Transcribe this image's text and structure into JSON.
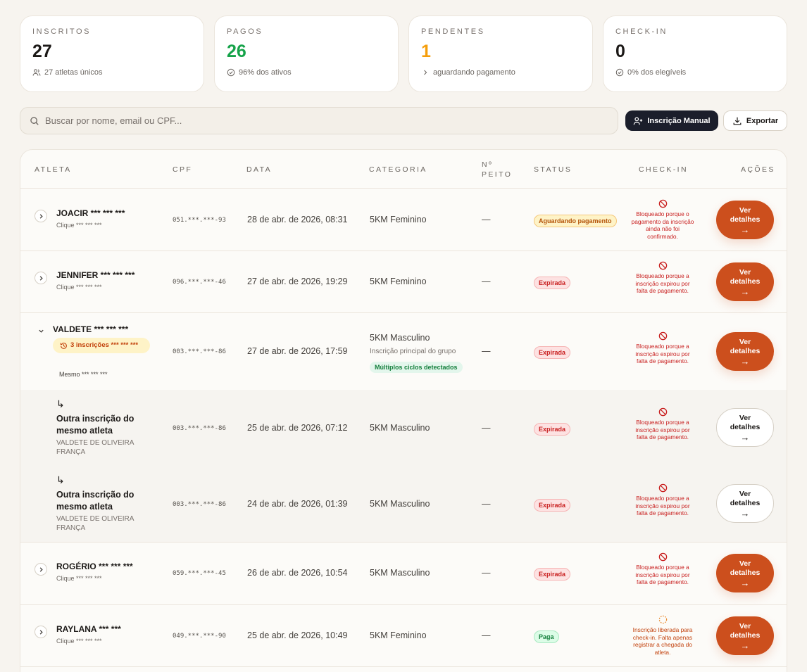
{
  "stats": [
    {
      "label": "INSCRITOS",
      "value": "27",
      "sub": "27 atletas únicos",
      "color": "#1c1917",
      "icon": "users-icon"
    },
    {
      "label": "PAGOS",
      "value": "26",
      "sub": "96% dos ativos",
      "color": "#16a34a",
      "icon": "check-circle-icon"
    },
    {
      "label": "PENDENTES",
      "value": "1",
      "sub": "aguardando pagamento",
      "color": "#f59e0b",
      "icon": "chevron-right-icon"
    },
    {
      "label": "CHECK-IN",
      "value": "0",
      "sub": "0% dos elegíveis",
      "color": "#1c1917",
      "icon": "check-circle-icon"
    }
  ],
  "search": {
    "placeholder": "Buscar por nome, email ou CPF..."
  },
  "buttons": {
    "manual": "Inscrição Manual",
    "export": "Exportar"
  },
  "table": {
    "headers": {
      "athlete": "ATLETA",
      "cpf": "CPF",
      "date": "DATA",
      "category": "CATEGORIA",
      "bib_line1": "Nº",
      "bib_line2": "PEITO",
      "status": "STATUS",
      "checkin": "CHECK-IN",
      "actions": "AÇÕES"
    },
    "rows": [
      {
        "name": "JOACIR *** *** ***",
        "sub": "Clique *** *** ***",
        "cpf": "051.***.***-93",
        "date": "28 de abr. de 2026, 08:31",
        "category": "5KM Feminino",
        "bib": "—",
        "status": "Aguardando pagamento",
        "checkin": "Bloqueado porque o pagamento da inscrição ainda não foi confirmado.",
        "action": "Ver detalhes"
      },
      {
        "name": "JENNIFER *** *** ***",
        "sub": "Clique *** *** ***",
        "cpf": "096.***.***-46",
        "date": "27 de abr. de 2026, 19:29",
        "category": "5KM Feminino",
        "bib": "—",
        "status": "Expirada",
        "checkin": "Bloqueado porque a inscrição expirou por falta de pagamento.",
        "action": "Ver detalhes"
      },
      {
        "name": "VALDETE *** *** ***",
        "multi": "3 inscrições *** *** ***",
        "sub": "Mesmo *** *** ***",
        "cpf": "003.***.***-86",
        "date": "27 de abr. de 2026, 17:59",
        "category": "5KM Masculino",
        "category_sub": "Inscrição principal do grupo",
        "cycles": "Múltiplos ciclos detectados",
        "bib": "—",
        "status": "Expirada",
        "checkin": "Bloqueado porque a inscrição expirou por falta de pagamento.",
        "action": "Ver detalhes"
      },
      {
        "arrow": "↳",
        "title": "Outra inscrição do mesmo atleta",
        "sub": "VALDETE DE OLIVEIRA FRANÇA",
        "cpf": "003.***.***-86",
        "date": "25 de abr. de 2026, 07:12",
        "category": "5KM Masculino",
        "bib": "—",
        "status": "Expirada",
        "checkin": "Bloqueado porque a inscrição expirou por falta de pagamento.",
        "action": "Ver detalhes"
      },
      {
        "arrow": "↳",
        "title": "Outra inscrição do mesmo atleta",
        "sub": "VALDETE DE OLIVEIRA FRANÇA",
        "cpf": "003.***.***-86",
        "date": "24 de abr. de 2026, 01:39",
        "category": "5KM Masculino",
        "bib": "—",
        "status": "Expirada",
        "checkin": "Bloqueado porque a inscrição expirou por falta de pagamento.",
        "action": "Ver detalhes"
      },
      {
        "name": "ROGÉRIO *** *** ***",
        "sub": "Clique *** *** ***",
        "cpf": "059.***.***-45",
        "date": "26 de abr. de 2026, 10:54",
        "category": "5KM Masculino",
        "bib": "—",
        "status": "Expirada",
        "checkin": "Bloqueado porque a inscrição expirou por falta de pagamento.",
        "action": "Ver detalhes"
      },
      {
        "name": "RAYLANA *** ***",
        "sub": "Clique *** *** ***",
        "cpf": "049.***.***-90",
        "date": "25 de abr. de 2026, 10:49",
        "category": "5KM Feminino",
        "bib": "—",
        "status": "Paga",
        "checkin": "Inscrição liberada para check-in. Falta apenas registrar a chegada do atleta.",
        "action": "Ver detalhes"
      }
    ]
  },
  "colors": {
    "accent": "#cc4f1d",
    "dark_button": "#1b1e2b",
    "expired": "#c81e1e",
    "pending": "#b45309",
    "paid": "#15803d"
  }
}
